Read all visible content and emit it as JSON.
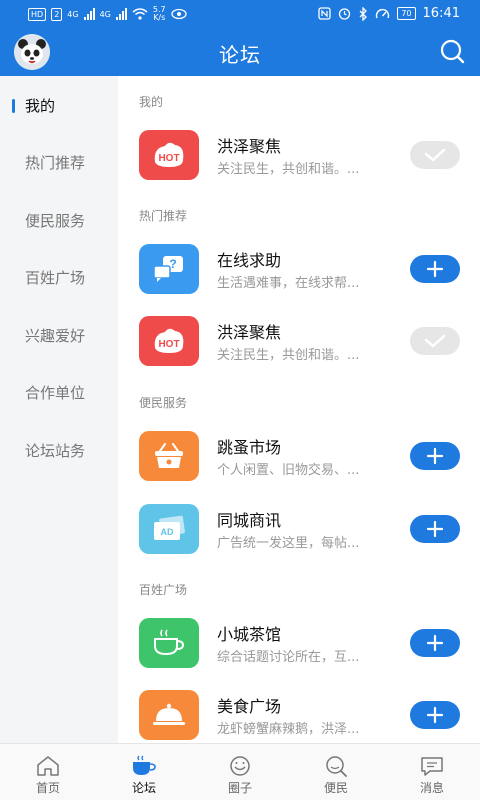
{
  "status_bar": {
    "hd_badge": "HD",
    "sim_badge": "2",
    "net_1": "4G",
    "net_2": "4G",
    "speed_value": "5.7",
    "speed_unit": "K/s",
    "battery": "70",
    "time": "16:41",
    "icons": [
      "nfc-icon",
      "alarm-icon",
      "bluetooth-icon",
      "speedometer-icon",
      "battery-icon"
    ]
  },
  "header": {
    "title": "论坛",
    "avatar_icon": "panda-avatar",
    "search_icon": "search-icon"
  },
  "sidebar": {
    "items": [
      {
        "label": "我的",
        "active": true
      },
      {
        "label": "热门推荐",
        "active": false
      },
      {
        "label": "便民服务",
        "active": false
      },
      {
        "label": "百姓广场",
        "active": false
      },
      {
        "label": "兴趣爱好",
        "active": false
      },
      {
        "label": "合作单位",
        "active": false
      },
      {
        "label": "论坛站务",
        "active": false
      }
    ]
  },
  "sections": [
    {
      "title": "我的",
      "rows": [
        {
          "name": "洪泽聚焦",
          "desc": "关注民生，共创和谐。...",
          "icon": "hot-icon",
          "icon_text": "HOT",
          "color": "#f04b4b",
          "state": "joined"
        }
      ]
    },
    {
      "title": "热门推荐",
      "rows": [
        {
          "name": "在线求助",
          "desc": "生活遇难事，在线求帮...",
          "icon": "help-chat-icon",
          "color": "#3a9af0",
          "state": "follow"
        },
        {
          "name": "洪泽聚焦",
          "desc": "关注民生，共创和谐。...",
          "icon": "hot-icon",
          "icon_text": "HOT",
          "color": "#f04b4b",
          "state": "joined"
        }
      ]
    },
    {
      "title": "便民服务",
      "rows": [
        {
          "name": "跳蚤市场",
          "desc": "个人闲置、旧物交易、...",
          "icon": "basket-icon",
          "color": "#f78a3a",
          "state": "follow"
        },
        {
          "name": "同城商讯",
          "desc": "广告统一发这里，每帖...",
          "icon": "ad-icon",
          "icon_text": "AD",
          "color": "#5fc4e8",
          "state": "follow"
        }
      ]
    },
    {
      "title": "百姓广场",
      "rows": [
        {
          "name": "小城茶馆",
          "desc": "综合话题讨论所在，互...",
          "icon": "tea-cup-icon",
          "color": "#3ec46a",
          "state": "follow"
        },
        {
          "name": "美食广场",
          "desc": "龙虾螃蟹麻辣鹅，洪泽...",
          "icon": "food-cloche-icon",
          "color": "#f78a3a",
          "state": "follow"
        }
      ]
    }
  ],
  "bottom_nav": [
    {
      "label": "首页",
      "icon": "home-icon",
      "active": false
    },
    {
      "label": "论坛",
      "icon": "forum-cup-icon",
      "active": true
    },
    {
      "label": "圈子",
      "icon": "circle-smile-icon",
      "active": false
    },
    {
      "label": "便民",
      "icon": "search-people-icon",
      "active": false
    },
    {
      "label": "消息",
      "icon": "message-icon",
      "active": false
    }
  ],
  "colors": {
    "primary": "#1f7ae0",
    "sidebar_bg": "#f4f5f7",
    "joined_btn": "#e6e6e6"
  }
}
